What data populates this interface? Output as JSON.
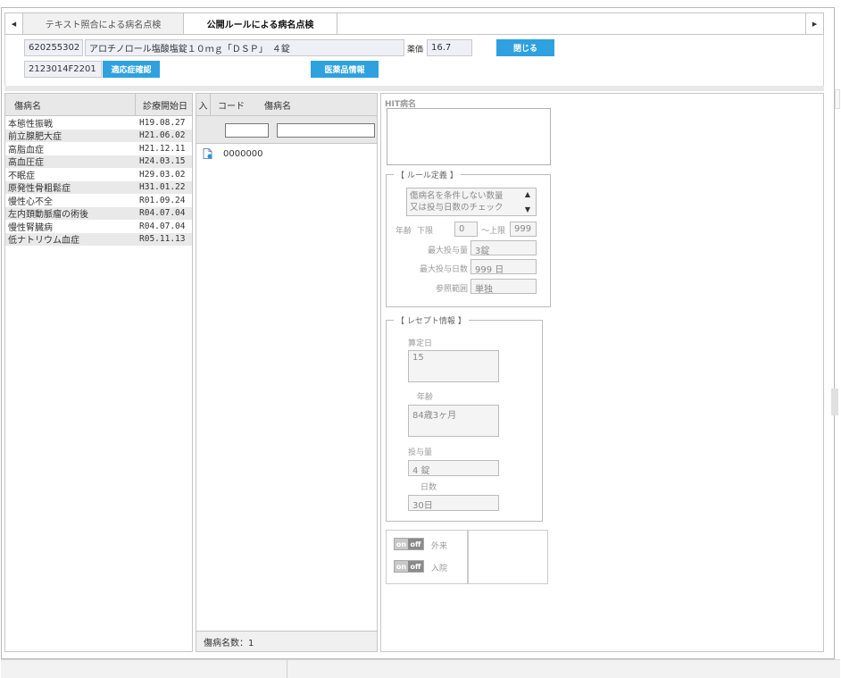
{
  "tabs": [
    {
      "label": "テキスト照合による病名点検"
    },
    {
      "label": "公開ルールによる病名点検"
    }
  ],
  "drug": {
    "code": "620255302",
    "name": "アロチノロール塩酸塩錠１０ｍｇ「ＤＳＰ」　４錠",
    "price_label": "薬価",
    "price_value": "16.7",
    "close_label": "閉じる",
    "yj_code": "2123014F2201",
    "indication_label": "適応症確認",
    "drug_info_label": "医薬品情報"
  },
  "left_table": {
    "headers": {
      "name": "傷病名",
      "date": "診療開始日"
    },
    "rows": [
      {
        "name": "本態性振戦",
        "date": "H19.08.27"
      },
      {
        "name": "前立腺肥大症",
        "date": "H21.06.02"
      },
      {
        "name": "高脂血症",
        "date": "H21.12.11"
      },
      {
        "name": "高血圧症",
        "date": "H24.03.15"
      },
      {
        "name": "不眠症",
        "date": "H29.03.02"
      },
      {
        "name": "原発性骨粗鬆症",
        "date": "H31.01.22"
      },
      {
        "name": "慢性心不全",
        "date": "R01.09.24"
      },
      {
        "name": "左内頚動脈瘤の術後",
        "date": "R04.07.04"
      },
      {
        "name": "慢性腎臓病",
        "date": "R04.07.04"
      },
      {
        "name": "低ナトリウム血症",
        "date": "R05.11.13"
      }
    ]
  },
  "mid_table": {
    "headers": {
      "in": "入",
      "code": "コード",
      "name": "傷病名"
    },
    "rows": [
      {
        "code": "0000000",
        "name": ""
      }
    ],
    "footer": "傷病名数：1"
  },
  "right_panel": {
    "hit_label": "HIT病名",
    "rule_legend": "【 ルール定義 】",
    "rule_select": "傷病名を条件しない数量又は投与日数のチェック",
    "age_label": "年齢",
    "lower_label": "下限",
    "lower_value": "0",
    "upper_label": "～上限",
    "upper_value": "999",
    "max_qty_label": "最大投与量",
    "max_qty_value": "3錠",
    "max_days_label": "最大投与日数",
    "max_days_value": "999 日",
    "range_label": "参照範囲",
    "range_value": "単独",
    "receipt_legend": "【 レセプト情報 】",
    "calc_day_label": "算定日",
    "calc_day_value": "15",
    "r_age_label": "年齢",
    "r_age_value": "84歳3ヶ月",
    "dose_label": "投与量",
    "dose_value": "4 錠",
    "days_label": "日数",
    "days_value": "30日",
    "toggle_on": "on",
    "toggle_off": "off",
    "outpatient_label": "外来",
    "inpatient_label": "入院"
  }
}
